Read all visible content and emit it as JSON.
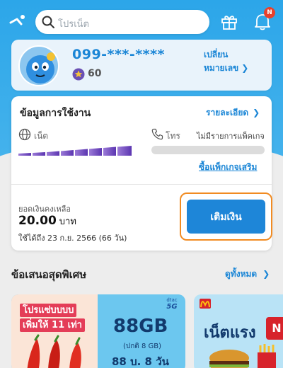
{
  "search": {
    "placeholder": "โปรเน็ต"
  },
  "notifications": {
    "badge": "N"
  },
  "profile": {
    "phone": "099-***-****",
    "points": "60",
    "change_number_label": "เปลี่ยนหมายเลข",
    "chevron": "❯"
  },
  "usage": {
    "title": "ข้อมูลการใช้งาน",
    "detail_label": "รายละเอียด",
    "chevron": "❯",
    "net_label": "เน็ต",
    "call_label": "โทร",
    "no_package": "ไม่มีรายการแพ็คเกจ",
    "buy_package": "ซื้อแพ็กเกจเสริม"
  },
  "balance": {
    "label": "ยอดเงินคงเหลือ",
    "amount": "20.00",
    "unit": "บาท",
    "valid_until": "ใช้ได้ถึง 23 ก.ย. 2566 (66 วัน)",
    "topup_label": "เติมเงิน"
  },
  "offers": {
    "title": "ข้อเสนอสุดพิเศษ",
    "see_all": "ดูทั้งหมด",
    "chevron": "❯",
    "promo1": {
      "line1": "โปรแซ่บบบบ",
      "line2": "เพิ่มให้ 11 เท่า",
      "brand": "dtac",
      "network": "5G",
      "big": "88GB",
      "strike": "(ปกติ 8 GB)",
      "price": "88 บ. 8 วัน"
    },
    "promo2": {
      "title": "เน็ตแรง",
      "tag": "N"
    }
  },
  "colors": {
    "brand_blue": "#1b86d6",
    "hero_blue": "#2ca6e9",
    "topup_border": "#f18b22",
    "badge_red": "#e8412c"
  }
}
